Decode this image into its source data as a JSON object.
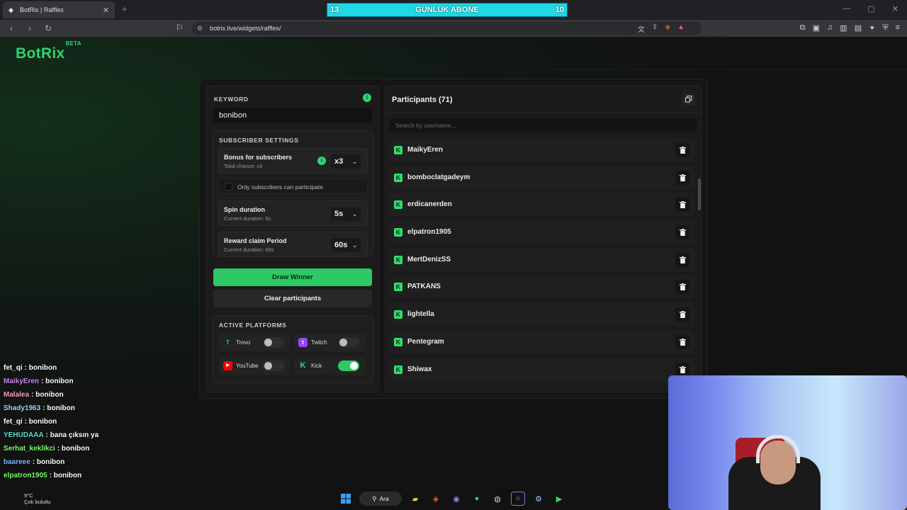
{
  "browser": {
    "tab_title": "BotRix | Raffles",
    "tab_close": "✕",
    "new_tab": "+",
    "url": "botrix.live/widgets/raffles/"
  },
  "overlay_bar": {
    "left": "13",
    "label": "GÜNLÜK ABONE",
    "right": "10"
  },
  "logo": {
    "text": "BotRix",
    "badge": "BETA"
  },
  "keyword": {
    "title": "KEYWORD",
    "value": "bonibon"
  },
  "subscriber_settings": {
    "title": "SUBSCRIBER SETTINGS",
    "bonus": {
      "label": "Bonus for subscribers",
      "sub": "Total chance: x3",
      "value": "x3"
    },
    "only_subs": {
      "label": "Only subscribers can participate",
      "checked": false
    },
    "spin": {
      "label": "Spin duration",
      "sub": "Current duration: 5s",
      "value": "5s"
    },
    "reward": {
      "label": "Reward claim Period",
      "sub": "Current duration: 60s",
      "value": "60s"
    }
  },
  "buttons": {
    "draw": "Draw Winner",
    "clear": "Clear participants"
  },
  "platforms": {
    "title": "ACTIVE PLATFORMS",
    "items": [
      {
        "name": "Trovo",
        "enabled": false,
        "color": "#19d66b",
        "glyph": "T"
      },
      {
        "name": "Twitch",
        "enabled": false,
        "color": "#9146ff",
        "glyph": "t"
      },
      {
        "name": "YouTube",
        "enabled": false,
        "color": "#ff0000",
        "glyph": "▶"
      },
      {
        "name": "Kick",
        "enabled": true,
        "color": "#2fe06e",
        "glyph": "K"
      }
    ]
  },
  "participants": {
    "title": "Participants (71)",
    "search_placeholder": "Search by username...",
    "list": [
      "MaikyEren",
      "bomboclatgadeym",
      "erdicanerden",
      "elpatron1905",
      "MertDenizSS",
      "PATKANS",
      "lightella",
      "Pentegram",
      "Shiwax"
    ]
  },
  "chat": [
    {
      "user": "fet_qi",
      "msg": ": bonibon",
      "color": "#ffffff"
    },
    {
      "user": "MaikyEren",
      "msg": ": bonibon",
      "color": "#c38cf0"
    },
    {
      "user": "Malalea",
      "msg": ": bonibon",
      "color": "#ff9ec8"
    },
    {
      "user": "Shady1963",
      "msg": ": bonibon",
      "color": "#9fd8ff"
    },
    {
      "user": "fet_qi",
      "msg": ": bonibon",
      "color": "#ffffff"
    },
    {
      "user": "YEHUDAAA",
      "msg": ": bana çıksın ya",
      "color": "#5fe0d0"
    },
    {
      "user": "Serhat_keklikci",
      "msg": ": bonibon",
      "color": "#7dff6a"
    },
    {
      "user": "baareee",
      "msg": ": bonibon",
      "color": "#7fb3ff"
    },
    {
      "user": "elpatron1905",
      "msg": ": bonibon",
      "color": "#7dff6a"
    }
  ],
  "taskbar": {
    "temp": "9°C",
    "weather": "Çok bulutlu",
    "search": "Ara"
  }
}
